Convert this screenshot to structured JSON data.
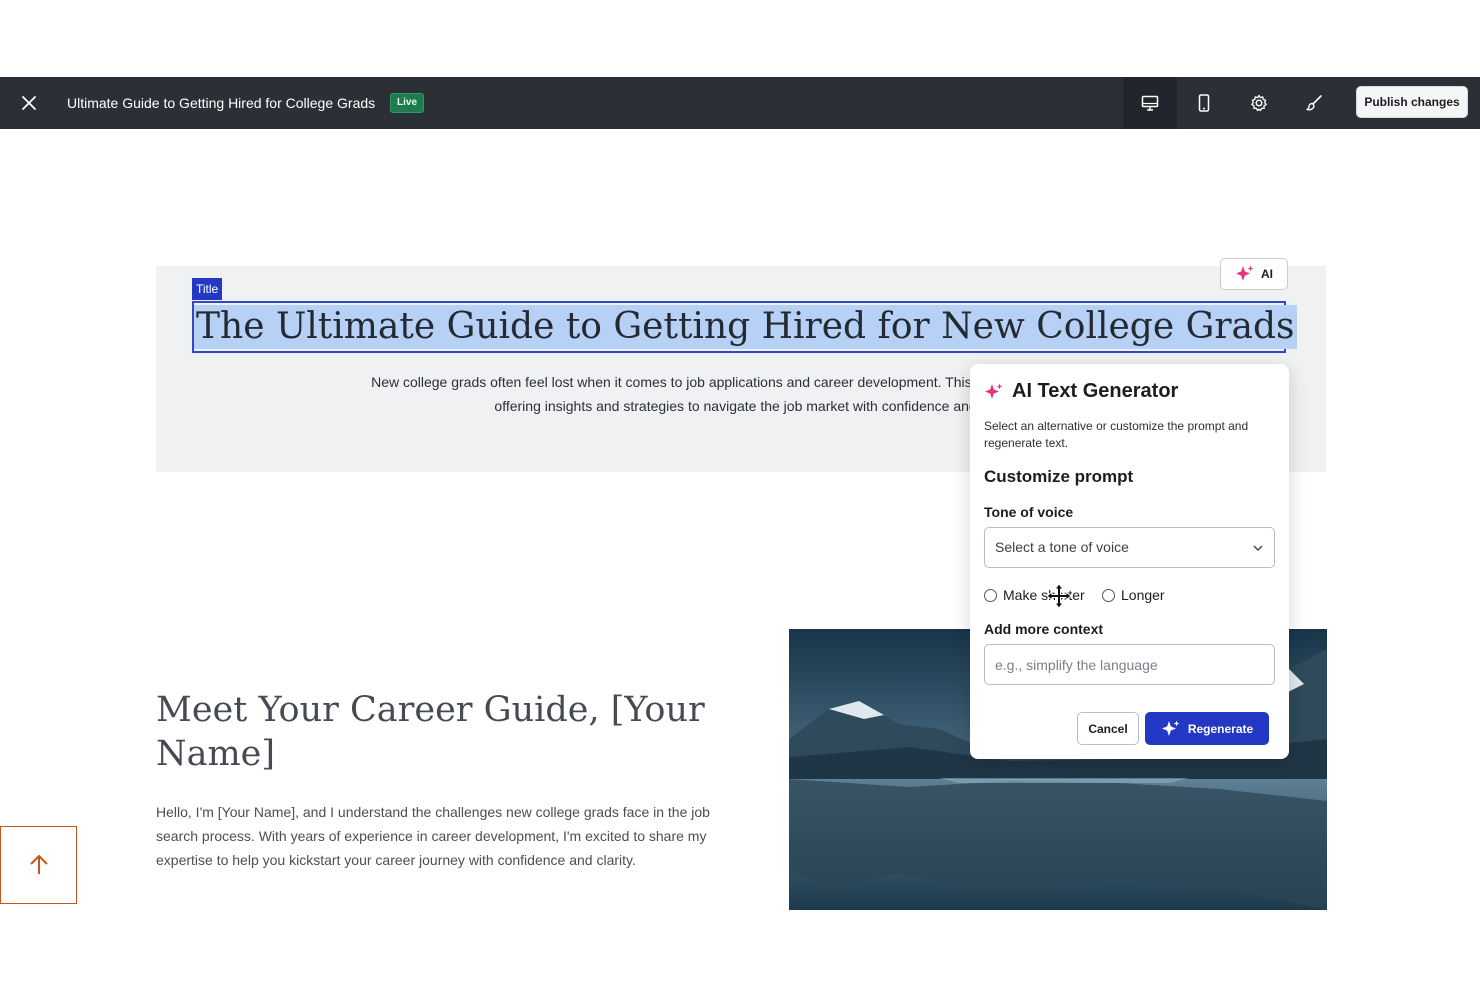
{
  "topbar": {
    "title": "Ultimate Guide to Getting Hired for College Grads",
    "status_badge": "Live",
    "tools": [
      "desktop-view-icon",
      "mobile-view-icon",
      "settings-gear-icon",
      "style-brush-icon"
    ],
    "publish_label": "Publish changes"
  },
  "hero": {
    "element_tag": "Title",
    "title": "The Ultimate Guide to Getting Hired for New College Grads",
    "desc_line1": "New college grads often feel lost when it comes to job applications and career development. This eBook is tailored for n",
    "desc_line2": "offering insights and strategies to navigate the job market with confidence and s",
    "ai_button": "AI"
  },
  "ai_panel": {
    "title": "AI Text Generator",
    "subtitle": "Select an alternative or customize the prompt and regenerate text.",
    "section_heading": "Customize prompt",
    "tone_label": "Tone of voice",
    "tone_placeholder": "Select a tone of voice",
    "option_shorter": "Make shorter",
    "option_longer": "Longer",
    "context_label": "Add more context",
    "context_placeholder": "e.g., simplify the language",
    "cancel_label": "Cancel",
    "regenerate_label": "Regenerate"
  },
  "about": {
    "title": "Meet Your Career Guide, [Your Name]",
    "body_line1": "Hello, I'm [Your Name], and I understand the challenges new college grads face in the job",
    "body_line2": "search process. With years of experience in career development, I'm excited to share my",
    "body_line3": "expertise to help you kickstart your career journey with confidence and clarity."
  },
  "colors": {
    "topbar_bg": "#2b2f36",
    "accent_blue": "#2338c4",
    "ai_pink": "#e8347a",
    "scroll_button_orange": "#c4561d"
  }
}
